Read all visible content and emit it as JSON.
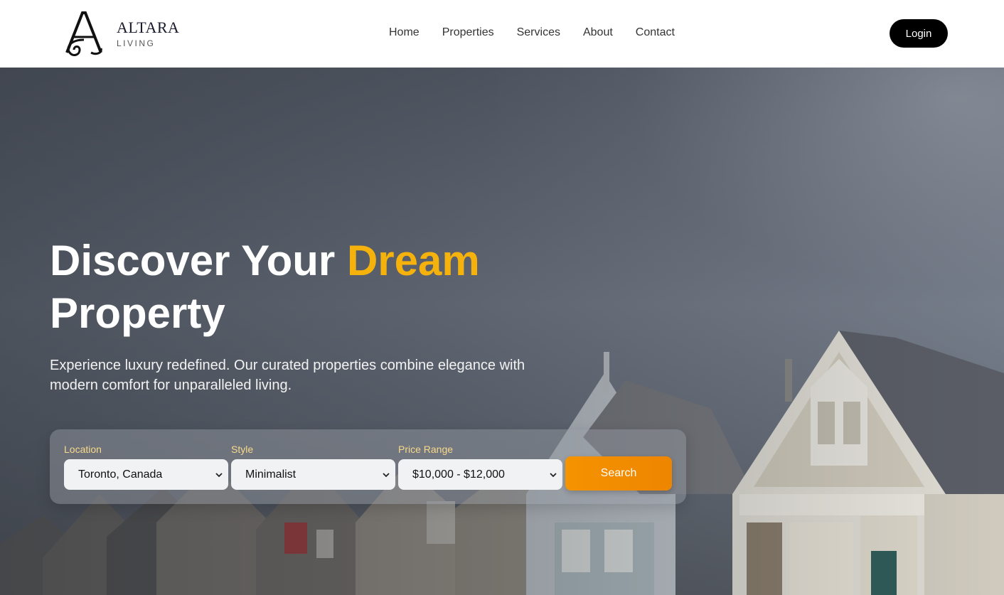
{
  "brand": {
    "name": "ALTARA",
    "tagline": "LIVING",
    "monogram": "A"
  },
  "nav": {
    "items": [
      {
        "label": "Home"
      },
      {
        "label": "Properties"
      },
      {
        "label": "Services"
      },
      {
        "label": "About"
      },
      {
        "label": "Contact"
      }
    ],
    "login_label": "Login"
  },
  "hero": {
    "title_part1": "Discover Your ",
    "title_accent": "Dream",
    "title_part2": "Property",
    "description": "Experience luxury redefined. Our curated properties combine elegance with modern comfort for unparalleled living.",
    "accent_color": "#f5b20d"
  },
  "search": {
    "location": {
      "label": "Location",
      "value": "Toronto, Canada"
    },
    "style": {
      "label": "Style",
      "value": "Minimalist"
    },
    "price": {
      "label": "Price Range",
      "value": "$10,000 - $12,000"
    },
    "button_label": "Search",
    "button_color": "#f59300"
  }
}
